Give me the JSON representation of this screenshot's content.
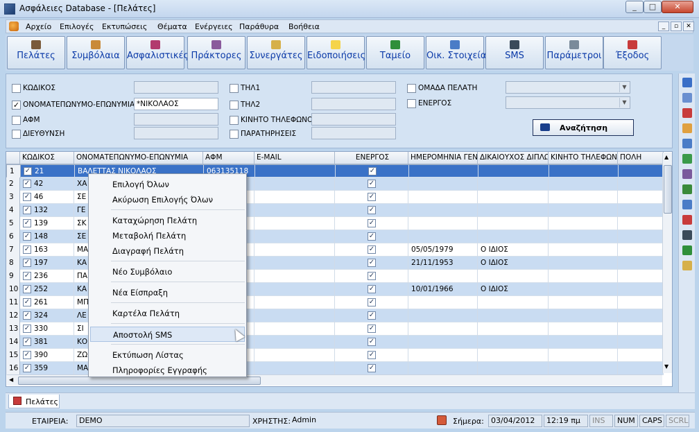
{
  "window": {
    "title": "Ασφάλειες Database - [Πελάτες]",
    "min": "_",
    "max": "□",
    "close": "✕"
  },
  "menu": {
    "items": [
      "Αρχείο",
      "Επιλογές",
      "Εκτυπώσεις",
      "Θέματα",
      "Ενέργειες",
      "Παράθυρα",
      "Βοήθεια"
    ],
    "mdi": [
      "_",
      "▫",
      "✕"
    ]
  },
  "toolbar": {
    "buttons": [
      {
        "label": "Πελάτες",
        "icon": "clients-icon",
        "color": "#7a5a3a"
      },
      {
        "label": "Συμβόλαια",
        "icon": "contracts-icon",
        "color": "#c98a3a"
      },
      {
        "label": "Ασφαλιστικές",
        "icon": "insurers-icon",
        "color": "#b23a6e"
      },
      {
        "label": "Πράκτορες",
        "icon": "agents-icon",
        "color": "#8a5a9c"
      },
      {
        "label": "Συνεργάτες",
        "icon": "partners-icon",
        "color": "#d6b04a"
      },
      {
        "label": "Ειδοποιήσεις",
        "icon": "notifications-icon",
        "color": "#f5d44a"
      },
      {
        "label": "Ταμείο",
        "icon": "cash-icon",
        "color": "#2f8f3a"
      },
      {
        "label": "Οικ. Στοιχεία",
        "icon": "financial-icon",
        "color": "#4a7cc7"
      },
      {
        "label": "SMS",
        "icon": "sms-icon",
        "color": "#3a4a5a"
      },
      {
        "label": "Παράμετροι",
        "icon": "settings-icon",
        "color": "#7a8a9a"
      },
      {
        "label": "Έξοδος",
        "icon": "exit-icon",
        "color": "#c83b3b"
      }
    ]
  },
  "filters": {
    "col1": [
      {
        "label": "ΚΩΔΙΚΟΣ",
        "checked": false,
        "value": ""
      },
      {
        "label": "ΟΝΟΜΑΤΕΠΩΝΥΜΟ-ΕΠΩΝΥΜΙΑ",
        "checked": true,
        "value": "*ΝΙΚΟΛΑΟΣ"
      },
      {
        "label": "ΑΦΜ",
        "checked": false,
        "value": ""
      },
      {
        "label": "ΔΙΕΥΘΥΝΣΗ",
        "checked": false,
        "value": ""
      }
    ],
    "col2": [
      {
        "label": "ΤΗΛ1",
        "checked": false,
        "value": ""
      },
      {
        "label": "ΤΗΛ2",
        "checked": false,
        "value": ""
      },
      {
        "label": "ΚΙΝΗΤΟ ΤΗΛΕΦΩΝΟ",
        "checked": false,
        "value": ""
      },
      {
        "label": "ΠΑΡΑΤΗΡΗΣΕΙΣ",
        "checked": false,
        "value": ""
      }
    ],
    "col3": [
      {
        "label": "ΟΜΑΔΑ ΠΕΛΑΤΗ",
        "checked": false,
        "value": ""
      },
      {
        "label": "ΕΝΕΡΓΟΣ",
        "checked": false,
        "value": ""
      }
    ],
    "search_label": "Αναζήτηση"
  },
  "grid": {
    "headers": [
      "ΚΩΔΙΚΟΣ",
      "ΟΝΟΜΑΤΕΠΩΝΥΜΟ-ΕΠΩΝΥΜΙΑ",
      "ΑΦΜ",
      "E-MAIL",
      "ΕΝΕΡΓΟΣ",
      "ΗΜΕΡΟΜΗΝΙΑ ΓΕΝΙ",
      "ΔΙΚΑΙΟΥΧΟΣ ΔΙΠΛΩ",
      "ΚΙΝΗΤΟ ΤΗΛΕΦΩΝ",
      "ΠΟΛΗ"
    ],
    "rows": [
      {
        "n": "1",
        "code": "21",
        "name": "ΒΑΛΕΤΤΑΣ ΝΙΚΟΛΑΟΣ",
        "afm": "063135118",
        "date": "",
        "benef": ""
      },
      {
        "n": "2",
        "code": "42",
        "name": "ΧΑ",
        "afm": "",
        "date": "",
        "benef": ""
      },
      {
        "n": "3",
        "code": "46",
        "name": "ΣΕ",
        "afm": "",
        "date": "",
        "benef": ""
      },
      {
        "n": "4",
        "code": "132",
        "name": "ΓΕ",
        "afm": "",
        "date": "",
        "benef": ""
      },
      {
        "n": "5",
        "code": "139",
        "name": "ΣΚ",
        "afm": "",
        "date": "",
        "benef": ""
      },
      {
        "n": "6",
        "code": "148",
        "name": "ΣΕ",
        "afm": "",
        "date": "",
        "benef": ""
      },
      {
        "n": "7",
        "code": "163",
        "name": "ΜΑ",
        "afm": "",
        "date": "05/05/1979",
        "benef": "Ο ΙΔΙΟΣ"
      },
      {
        "n": "8",
        "code": "197",
        "name": "ΚΑ",
        "afm": "",
        "date": "21/11/1953",
        "benef": "Ο ΙΔΙΟΣ"
      },
      {
        "n": "9",
        "code": "236",
        "name": "ΠΑ",
        "afm": "",
        "date": "",
        "benef": ""
      },
      {
        "n": "10",
        "code": "252",
        "name": "ΚΑ",
        "afm": "",
        "date": "10/01/1966",
        "benef": "Ο ΙΔΙΟΣ"
      },
      {
        "n": "11",
        "code": "261",
        "name": "ΜΠ",
        "afm": "",
        "date": "",
        "benef": ""
      },
      {
        "n": "12",
        "code": "324",
        "name": "ΛΕ",
        "afm": "",
        "date": "",
        "benef": ""
      },
      {
        "n": "13",
        "code": "330",
        "name": "ΣΙ",
        "afm": "",
        "date": "",
        "benef": ""
      },
      {
        "n": "14",
        "code": "381",
        "name": "ΚΟ",
        "afm": "",
        "date": "",
        "benef": ""
      },
      {
        "n": "15",
        "code": "390",
        "name": "ΖΩ",
        "afm": "",
        "date": "",
        "benef": ""
      },
      {
        "n": "16",
        "code": "359",
        "name": "ΜΑ",
        "afm": "",
        "date": "",
        "benef": ""
      }
    ]
  },
  "context_menu": {
    "groups": [
      [
        "Επιλογή Όλων",
        "Ακύρωση Επιλογής Όλων"
      ],
      [
        "Καταχώρηση Πελάτη",
        "Μεταβολή Πελάτη",
        "Διαγραφή Πελάτη"
      ],
      [
        "Νέο Συμβόλαιο"
      ],
      [
        "Νέα Είσπραξη"
      ],
      [
        "Καρτέλα Πελάτη"
      ],
      [
        "Αποστολή SMS"
      ],
      [
        "Εκτύπωση Λίστας",
        "Πληροφορίες Εγγραφής"
      ]
    ],
    "highlighted": "Αποστολή SMS"
  },
  "tab": {
    "label": "Πελάτες"
  },
  "status": {
    "company_label": "ΕΤΑΙΡΕΙΑ:",
    "company": "DEMO",
    "user_label": "ΧΡΗΣΤΗΣ:",
    "user": "Admin",
    "today_label": "Σήμερα:",
    "date": "03/04/2012",
    "time": "12:19 πμ",
    "ins": "INS",
    "num": "NUM",
    "caps": "CAPS",
    "scrl": "SCRL"
  },
  "colors": {
    "selected_row": "#3a72c7",
    "alt_row": "#c9dcf2",
    "accent": "#0b3aa8"
  }
}
